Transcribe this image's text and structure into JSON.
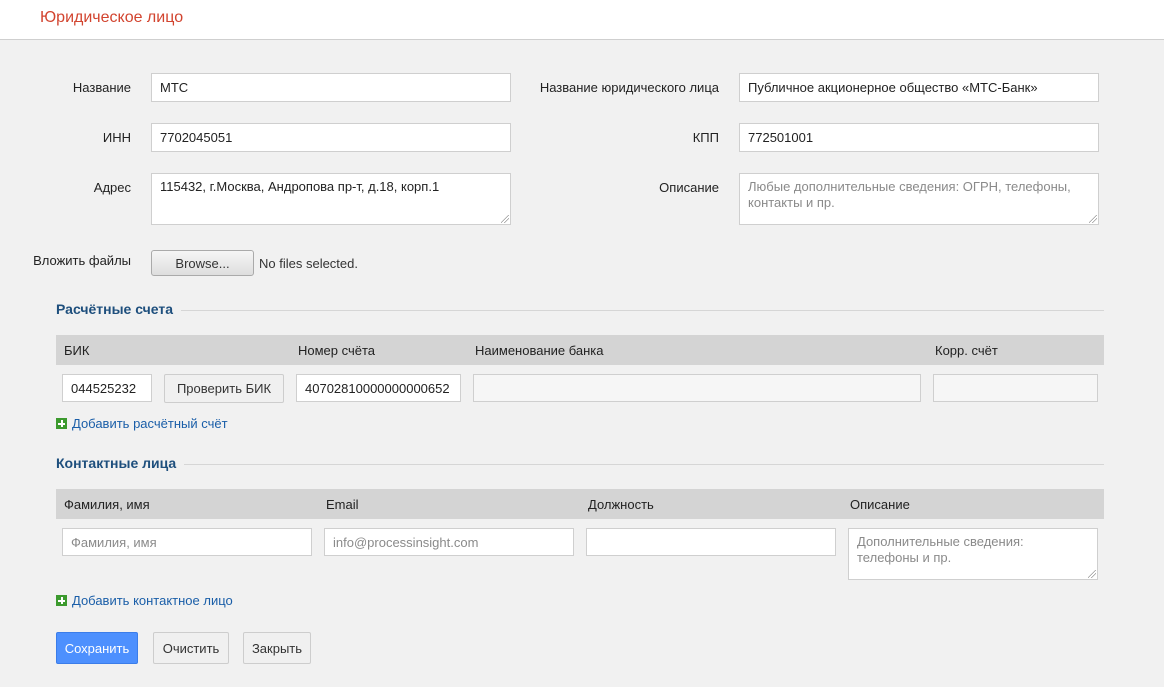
{
  "header": {
    "title": "Юридическое лицо"
  },
  "form": {
    "name_label": "Название",
    "name_value": "МТС",
    "legal_name_label": "Название юридического лица",
    "legal_name_value": "Публичное акционерное общество «МТС-Банк»",
    "inn_label": "ИНН",
    "inn_value": "7702045051",
    "kpp_label": "КПП",
    "kpp_value": "772501001",
    "address_label": "Адрес",
    "address_value": "115432, г.Москва, Андропова пр-т, д.18, корп.1",
    "description_label": "Описание",
    "description_placeholder": "Любые дополнительные сведения: ОГРН, телефоны, контакты и пр.",
    "files_label": "Вложить файлы",
    "browse_label": "Browse...",
    "files_status": "No files selected."
  },
  "accounts": {
    "title": "Расчётные счета",
    "columns": [
      "БИК",
      "Номер счёта",
      "Наименование банка",
      "Корр. счёт"
    ],
    "rows": [
      {
        "bik": "044525232",
        "check_label": "Проверить БИК",
        "account": "40702810000000000652",
        "bank_name": "",
        "corr_account": ""
      }
    ],
    "add_label": "Добавить расчётный счёт"
  },
  "contacts": {
    "title": "Контактные лица",
    "columns": [
      "Фамилия, имя",
      "Email",
      "Должность",
      "Описание"
    ],
    "rows": [
      {
        "name_placeholder": "Фамилия, имя",
        "email_placeholder": "info@processinsight.com",
        "position": "",
        "description_placeholder": "Дополнительные сведения: телефоны и пр."
      }
    ],
    "add_label": "Добавить контактное лицо"
  },
  "actions": {
    "save_label": "Сохранить",
    "clear_label": "Очистить",
    "close_label": "Закрыть"
  },
  "colors": {
    "title": "#d2442f",
    "section_title": "#1e4f7d",
    "link": "#1a5ea8",
    "primary_button": "#4d90fe",
    "plus_icon": "#3c9a2e",
    "table_header": "#d4d4d4"
  }
}
